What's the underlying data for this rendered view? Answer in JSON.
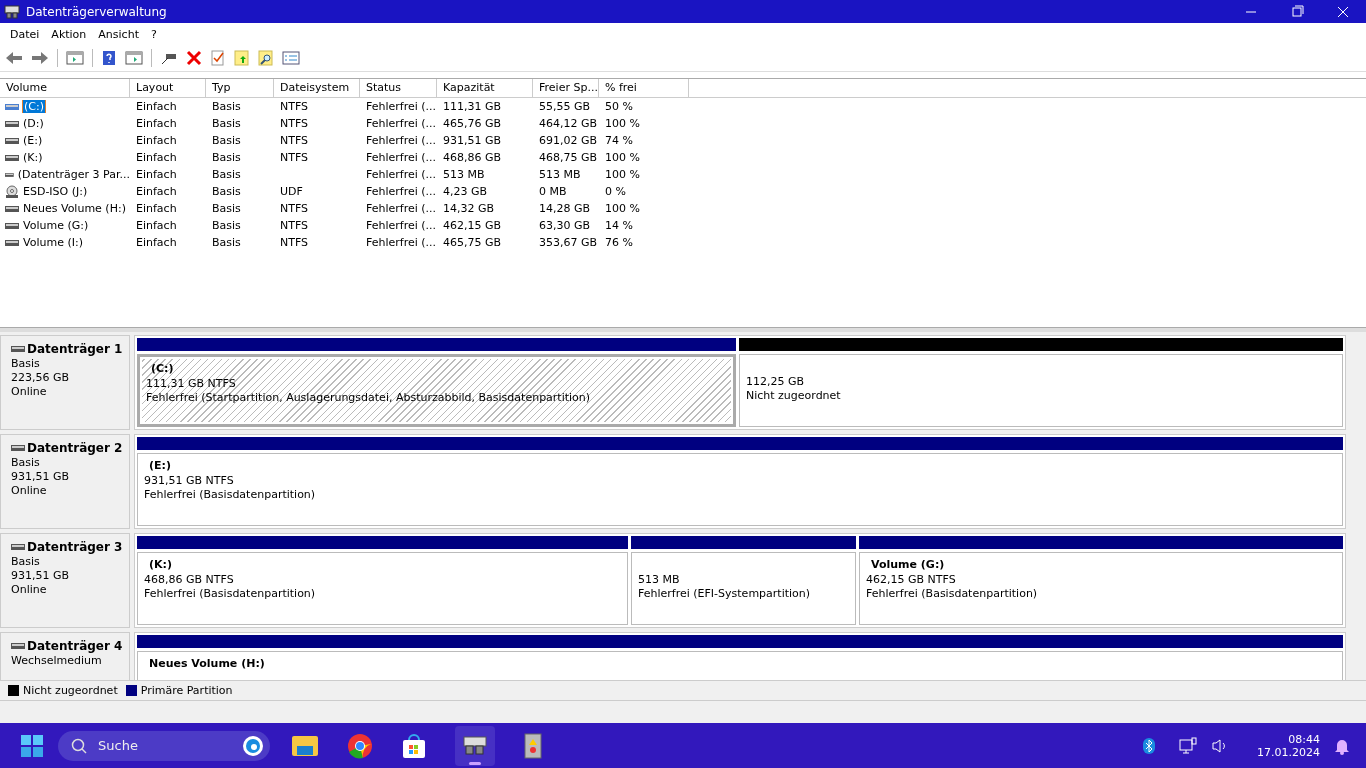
{
  "window": {
    "title": "Datenträgerverwaltung"
  },
  "menu": [
    "Datei",
    "Aktion",
    "Ansicht",
    "?"
  ],
  "table": {
    "columns": [
      "Volume",
      "Layout",
      "Typ",
      "Dateisystem",
      "Status",
      "Kapazität",
      "Freier Sp...",
      "% frei"
    ],
    "rows": [
      {
        "kind": "disk",
        "selected": true,
        "cells": [
          "(C:)",
          "Einfach",
          "Basis",
          "NTFS",
          "Fehlerfrei (...",
          "111,31 GB",
          "55,55 GB",
          "50 %"
        ]
      },
      {
        "kind": "disk",
        "selected": false,
        "cells": [
          "(D:)",
          "Einfach",
          "Basis",
          "NTFS",
          "Fehlerfrei (...",
          "465,76 GB",
          "464,12 GB",
          "100 %"
        ]
      },
      {
        "kind": "disk",
        "selected": false,
        "cells": [
          "(E:)",
          "Einfach",
          "Basis",
          "NTFS",
          "Fehlerfrei (...",
          "931,51 GB",
          "691,02 GB",
          "74 %"
        ]
      },
      {
        "kind": "disk",
        "selected": false,
        "cells": [
          "(K:)",
          "Einfach",
          "Basis",
          "NTFS",
          "Fehlerfrei (...",
          "468,86 GB",
          "468,75 GB",
          "100 %"
        ]
      },
      {
        "kind": "disk",
        "selected": false,
        "cells": [
          "(Datenträger 3 Par...",
          "Einfach",
          "Basis",
          "",
          "Fehlerfrei (...",
          "513 MB",
          "513 MB",
          "100 %"
        ]
      },
      {
        "kind": "cd",
        "selected": false,
        "cells": [
          "ESD-ISO (J:)",
          "Einfach",
          "Basis",
          "UDF",
          "Fehlerfrei (...",
          "4,23 GB",
          "0 MB",
          "0 %"
        ]
      },
      {
        "kind": "disk",
        "selected": false,
        "cells": [
          "Neues Volume (H:)",
          "Einfach",
          "Basis",
          "NTFS",
          "Fehlerfrei (...",
          "14,32 GB",
          "14,28 GB",
          "100 %"
        ]
      },
      {
        "kind": "disk",
        "selected": false,
        "cells": [
          "Volume (G:)",
          "Einfach",
          "Basis",
          "NTFS",
          "Fehlerfrei (...",
          "462,15 GB",
          "63,30 GB",
          "14 %"
        ]
      },
      {
        "kind": "disk",
        "selected": false,
        "cells": [
          "Volume (I:)",
          "Einfach",
          "Basis",
          "NTFS",
          "Fehlerfrei (...",
          "465,75 GB",
          "353,67 GB",
          "76 %"
        ]
      }
    ]
  },
  "disks": [
    {
      "name": "Datenträger 1",
      "lines": [
        "Basis",
        "223,56 GB",
        "Online"
      ],
      "partitions": [
        {
          "kind": "primary",
          "selected": true,
          "title": "(C:)",
          "lines": [
            "111,31 GB NTFS",
            "Fehlerfrei (Startpartition, Auslagerungsdatei, Absturzabbild, Basisdatenpartition)"
          ]
        },
        {
          "kind": "unallocated",
          "selected": false,
          "lines": [
            "112,25 GB",
            "Nicht zugeordnet"
          ]
        }
      ]
    },
    {
      "name": "Datenträger 2",
      "lines": [
        "Basis",
        "931,51 GB",
        "Online"
      ],
      "partitions": [
        {
          "kind": "primary",
          "selected": false,
          "title": "(E:)",
          "lines": [
            "931,51 GB NTFS",
            "Fehlerfrei (Basisdatenpartition)"
          ]
        }
      ]
    },
    {
      "name": "Datenträger 3",
      "lines": [
        "Basis",
        "931,51 GB",
        "Online"
      ],
      "partitions": [
        {
          "kind": "primary",
          "selected": false,
          "title": "(K:)",
          "lines": [
            "468,86 GB NTFS",
            "Fehlerfrei (Basisdatenpartition)"
          ]
        },
        {
          "kind": "primary",
          "selected": false,
          "lines": [
            "513 MB",
            "Fehlerfrei (EFI-Systempartition)"
          ]
        },
        {
          "kind": "primary",
          "selected": false,
          "title": "Volume  (G:)",
          "lines": [
            "462,15 GB NTFS",
            "Fehlerfrei (Basisdatenpartition)"
          ]
        }
      ]
    },
    {
      "name": "Datenträger 4",
      "lines": [
        "Wechselmedium"
      ],
      "partitions": [
        {
          "kind": "primary",
          "selected": false,
          "title": "Neues Volume  (H:)"
        }
      ]
    }
  ],
  "legend": [
    {
      "label": "Nicht zugeordnet",
      "color": "#000000"
    },
    {
      "label": "Primäre Partition",
      "color": "#000080"
    }
  ],
  "taskbar": {
    "search": {
      "placeholder": "Suche"
    },
    "time": "08:44",
    "date": "17.01.2024"
  }
}
